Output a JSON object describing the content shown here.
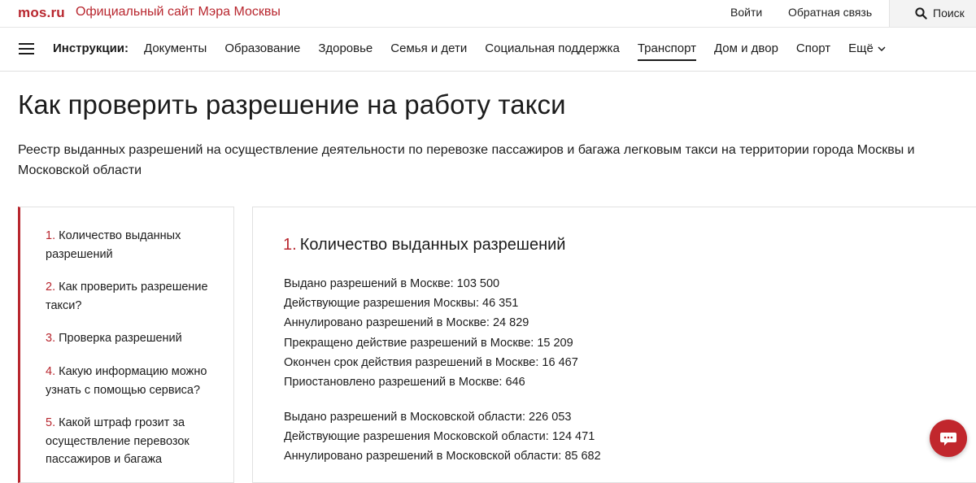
{
  "topbar": {
    "logo": "mos.ru",
    "official_site": "Официальный сайт Мэра Москвы",
    "login": "Войти",
    "feedback": "Обратная связь",
    "search": "Поиск"
  },
  "nav": {
    "title": "Инструкции:",
    "items": [
      {
        "label": "Документы"
      },
      {
        "label": "Образование"
      },
      {
        "label": "Здоровье"
      },
      {
        "label": "Семья и дети"
      },
      {
        "label": "Социальная поддержка"
      },
      {
        "label": "Транспорт",
        "active": true
      },
      {
        "label": "Дом и двор"
      },
      {
        "label": "Спорт"
      },
      {
        "label": "Ещё"
      }
    ]
  },
  "page": {
    "title": "Как проверить разрешение на работу такси",
    "lead": "Реестр выданных разрешений на осуществление деятельности по перевозке пассажиров и багажа легковым такси на территории города Москвы и Московской области"
  },
  "toc": [
    {
      "num": "1.",
      "label": "Количество выданных разрешений"
    },
    {
      "num": "2.",
      "label": "Как проверить разрешение такси?"
    },
    {
      "num": "3.",
      "label": "Проверка разрешений"
    },
    {
      "num": "4.",
      "label": "Какую информацию можно узнать с помощью сервиса?"
    },
    {
      "num": "5.",
      "label": "Какой штраф грозит за осуществление перевозок пассажиров и багажа"
    }
  ],
  "section": {
    "num": "1.",
    "title": "Количество выданных разрешений",
    "moscow": [
      "Выдано разрешений в Москве: 103 500",
      "Действующие разрешения Москвы: 46 351",
      "Аннулировано разрешений в Москве: 24 829",
      "Прекращено действие разрешений в Москве: 15 209",
      "Окончен срок действия разрешений в Москве: 16 467",
      "Приостановлено разрешений в Москве: 646"
    ],
    "region": [
      "Выдано разрешений в Московской области: 226 053",
      "Действующие разрешения Московской области: 124 471",
      "Аннулировано разрешений в Московской области: 85 682"
    ]
  },
  "colors": {
    "accent": "#b8262e",
    "chat": "#c1272d"
  },
  "icons": {
    "menu": "hamburger-icon",
    "search": "search-icon",
    "more": "chevron-down-icon",
    "chat": "chat-bubble-icon"
  }
}
